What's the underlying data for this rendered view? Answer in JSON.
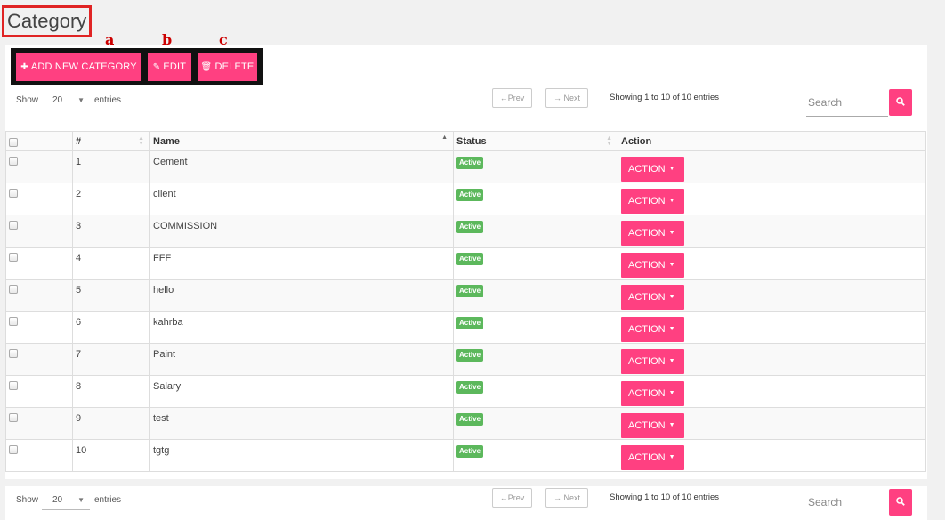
{
  "page": {
    "title": "Category"
  },
  "annotations": [
    "a",
    "b",
    "c"
  ],
  "toolbar": {
    "add_label": "ADD NEW CATEGORY",
    "edit_label": "EDIT",
    "delete_label": "DELETE"
  },
  "controls": {
    "show_label": "Show",
    "entries_label": "entries",
    "page_size": "20",
    "prev_label": "←Prev",
    "next_label": "→ Next",
    "info": "Showing 1 to 10 of 10 entries",
    "search_placeholder": "Search"
  },
  "table": {
    "columns": [
      "#",
      "Name",
      "Status",
      "Action"
    ],
    "action_label": "ACTION",
    "rows": [
      {
        "num": "1",
        "name": "Cement",
        "status": "Active"
      },
      {
        "num": "2",
        "name": "client",
        "status": "Active"
      },
      {
        "num": "3",
        "name": "COMMISSION",
        "status": "Active"
      },
      {
        "num": "4",
        "name": "FFF",
        "status": "Active"
      },
      {
        "num": "5",
        "name": "hello",
        "status": "Active"
      },
      {
        "num": "6",
        "name": "kahrba",
        "status": "Active"
      },
      {
        "num": "7",
        "name": "Paint",
        "status": "Active"
      },
      {
        "num": "8",
        "name": "Salary",
        "status": "Active"
      },
      {
        "num": "9",
        "name": "test",
        "status": "Active"
      },
      {
        "num": "10",
        "name": "tgtg",
        "status": "Active"
      }
    ]
  },
  "colors": {
    "accent": "#ff4081",
    "status_active": "#5cb85c",
    "highlight_red": "#e02424"
  }
}
